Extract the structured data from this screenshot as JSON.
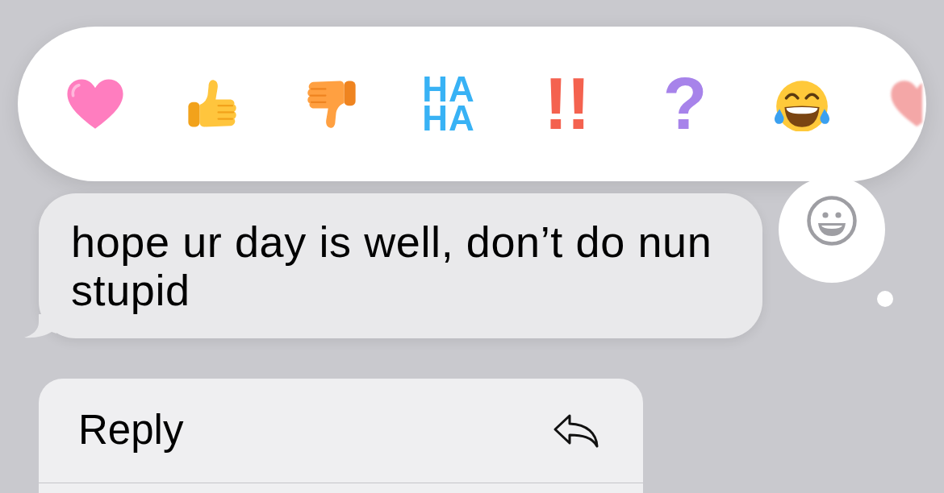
{
  "reaction_bar": {
    "reactions": [
      {
        "kind": "heart",
        "color": "#ff7dbf"
      },
      {
        "kind": "thumbsup"
      },
      {
        "kind": "thumbsdown"
      },
      {
        "kind": "stacked",
        "label": "HA HA",
        "color": "#38b2f5"
      },
      {
        "kind": "symbol",
        "label": "!!",
        "color": "#f4624f"
      },
      {
        "kind": "symbol",
        "label": "?",
        "color": "#a783ea"
      },
      {
        "kind": "laughing"
      },
      {
        "kind": "heart",
        "color": "#f4a7a7"
      }
    ]
  },
  "message": {
    "text": "hope ur day is well, don’t do nun stupid"
  },
  "context_menu": {
    "items": [
      {
        "label": "Reply"
      }
    ]
  }
}
